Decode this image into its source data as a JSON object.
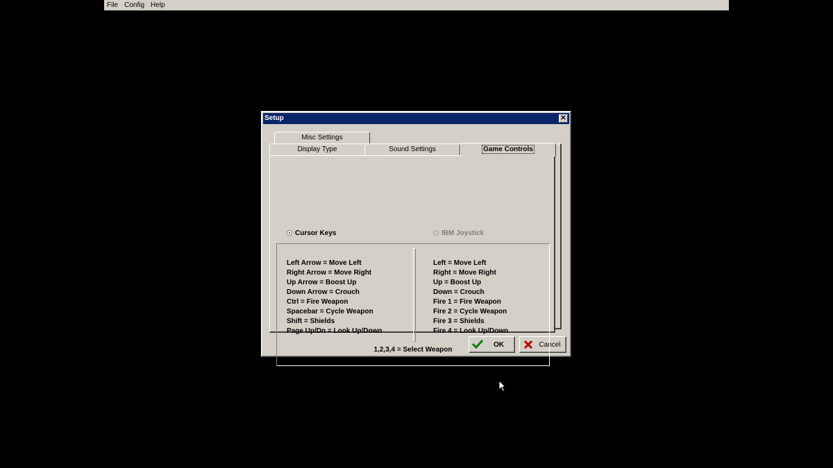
{
  "menubar": {
    "items": [
      "File",
      "Config",
      "Help"
    ]
  },
  "dialog": {
    "title": "Setup",
    "close_glyph": "✕",
    "tabs": {
      "misc": "Misc Settings",
      "display": "Display Type",
      "sound": "Sound Settings",
      "controls": "Game Controls"
    },
    "active_tab": "Game Controls",
    "input_options": [
      {
        "label": "Cursor Keys",
        "selected": true,
        "enabled": true
      },
      {
        "label": "IBM Joystick",
        "selected": false,
        "enabled": false
      }
    ],
    "keyboard_mappings": [
      "Left Arrow = Move Left",
      "Right Arrow = Move Right",
      "Up Arrow = Boost Up",
      "Down Arrow = Crouch",
      "Ctrl = Fire Weapon",
      "Spacebar = Cycle Weapon",
      "Shift = Shields",
      "Page Up/Dn = Look Up/Down"
    ],
    "joystick_mappings": [
      "Left = Move Left",
      "Right = Move Right",
      "Up = Boost Up",
      "Down = Crouch",
      "Fire 1 = Fire Weapon",
      "Fire 2 = Cycle Weapon",
      "Fire 3 = Shields",
      "Fire 4 = Look Up/Down"
    ],
    "select_weapon": "1,2,3,4 = Select Weapon",
    "buttons": {
      "ok": {
        "label": "OK",
        "icon": "checkmark-icon",
        "color": "#008000"
      },
      "cancel": {
        "label": "Cancel",
        "icon": "x-icon",
        "color": "#c00000"
      }
    }
  },
  "colors": {
    "desktop": "#000000",
    "face": "#d4d0c8",
    "titlebar": "#0a246a"
  }
}
